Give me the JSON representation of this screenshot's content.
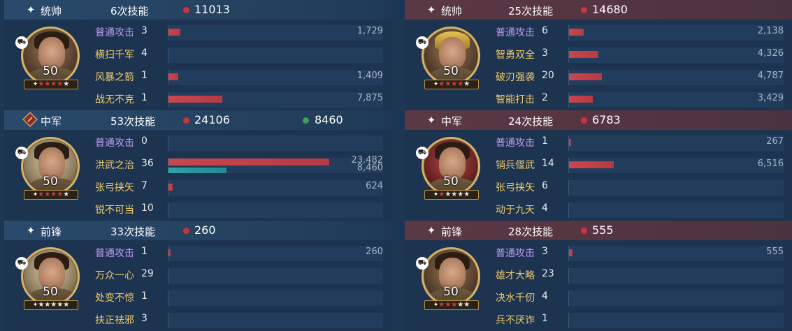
{
  "panels": [
    {
      "side": "left",
      "sections": [
        {
          "role_label": "统帅",
          "role_icon": "sparkle-icon",
          "skill_count": "6次技能",
          "damage": "11013",
          "heal": null,
          "level": "50",
          "stars": {
            "red": 4,
            "total": 5
          },
          "skills": [
            {
              "name": "普通攻击",
              "type": "normal",
              "count": "3",
              "damage": 1729,
              "damage_label": "1,729"
            },
            {
              "name": "横扫千军",
              "type": "tactic",
              "count": "4",
              "damage": 0,
              "damage_label": ""
            },
            {
              "name": "风暴之箭",
              "type": "tactic",
              "count": "1",
              "damage": 1409,
              "damage_label": "1,409"
            },
            {
              "name": "战无不克",
              "type": "tactic",
              "count": "1",
              "damage": 7875,
              "damage_label": "7,875"
            }
          ]
        },
        {
          "role_label": "中军",
          "role_icon": "red-diamond-badge-icon",
          "skill_count": "53次技能",
          "damage": "24106",
          "heal": "8460",
          "level": "50",
          "stars": {
            "red": 4,
            "total": 5
          },
          "skills": [
            {
              "name": "普通攻击",
              "type": "normal",
              "count": "0",
              "damage": 0,
              "damage_label": ""
            },
            {
              "name": "洪武之治",
              "type": "tactic",
              "count": "36",
              "damage": 23482,
              "damage_label": "23,482",
              "heal": 8460,
              "heal_label": "8,460"
            },
            {
              "name": "张弓挟矢",
              "type": "tactic",
              "count": "7",
              "damage": 624,
              "damage_label": "624"
            },
            {
              "name": "锐不可当",
              "type": "tactic",
              "count": "10",
              "damage": 0,
              "damage_label": ""
            }
          ]
        },
        {
          "role_label": "前锋",
          "role_icon": "sparkle-icon",
          "skill_count": "33次技能",
          "damage": "260",
          "heal": null,
          "level": "50",
          "stars": {
            "red": 0,
            "total": 5
          },
          "skills": [
            {
              "name": "普通攻击",
              "type": "normal",
              "count": "1",
              "damage": 260,
              "damage_label": "260"
            },
            {
              "name": "万众一心",
              "type": "tactic",
              "count": "29",
              "damage": 0,
              "damage_label": ""
            },
            {
              "name": "处变不惊",
              "type": "tactic",
              "count": "1",
              "damage": 0,
              "damage_label": ""
            },
            {
              "name": "扶正祛邪",
              "type": "tactic",
              "count": "3",
              "damage": 0,
              "damage_label": ""
            }
          ]
        }
      ]
    },
    {
      "side": "right",
      "sections": [
        {
          "role_label": "统帅",
          "role_icon": "sparkle-icon",
          "skill_count": "25次技能",
          "damage": "14680",
          "heal": null,
          "level": "50",
          "stars": {
            "red": 4,
            "total": 5
          },
          "skills": [
            {
              "name": "普通攻击",
              "type": "normal",
              "count": "6",
              "damage": 2138,
              "damage_label": "2,138"
            },
            {
              "name": "智勇双全",
              "type": "tactic",
              "count": "3",
              "damage": 4326,
              "damage_label": "4,326"
            },
            {
              "name": "破刃强袭",
              "type": "tactic",
              "count": "20",
              "damage": 4787,
              "damage_label": "4,787"
            },
            {
              "name": "智能打击",
              "type": "tactic",
              "count": "2",
              "damage": 3429,
              "damage_label": "3,429"
            }
          ]
        },
        {
          "role_label": "中军",
          "role_icon": "sparkle-icon",
          "skill_count": "24次技能",
          "damage": "6783",
          "heal": null,
          "level": "50",
          "stars": {
            "red": 1,
            "total": 5
          },
          "skills": [
            {
              "name": "普通攻击",
              "type": "normal",
              "count": "1",
              "damage": 267,
              "damage_label": "267"
            },
            {
              "name": "销兵偃武",
              "type": "tactic",
              "count": "14",
              "damage": 6516,
              "damage_label": "6,516"
            },
            {
              "name": "张弓挟矢",
              "type": "tactic",
              "count": "6",
              "damage": 0,
              "damage_label": ""
            },
            {
              "name": "动于九天",
              "type": "tactic",
              "count": "4",
              "damage": 0,
              "damage_label": ""
            }
          ]
        },
        {
          "role_label": "前锋",
          "role_icon": "sparkle-icon",
          "skill_count": "28次技能",
          "damage": "555",
          "heal": null,
          "level": "50",
          "stars": {
            "red": 3,
            "total": 5
          },
          "skills": [
            {
              "name": "普通攻击",
              "type": "normal",
              "count": "3",
              "damage": 555,
              "damage_label": "555"
            },
            {
              "name": "雄才大略",
              "type": "tactic",
              "count": "23",
              "damage": 0,
              "damage_label": ""
            },
            {
              "name": "决水千仞",
              "type": "tactic",
              "count": "4",
              "damage": 0,
              "damage_label": ""
            },
            {
              "name": "兵不厌诈",
              "type": "tactic",
              "count": "1",
              "damage": 0,
              "damage_label": ""
            }
          ]
        }
      ]
    }
  ],
  "bar_scale_max": 23482,
  "colors": {
    "damage": "#c9353f",
    "heal": "#3fa15d",
    "heal_bar": "#2ea2a6",
    "normal_attack": "#c19af2",
    "tactic": "#f2c96b",
    "left_header": "#2a4a6c",
    "right_header": "#5a3844"
  }
}
